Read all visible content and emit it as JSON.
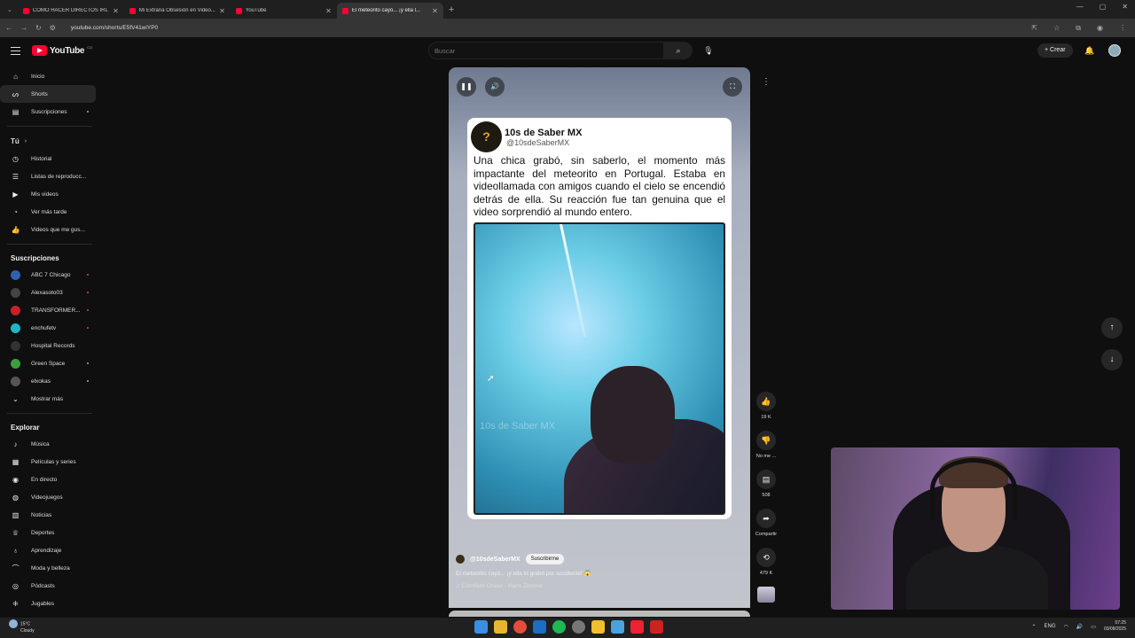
{
  "browser": {
    "tabs": [
      {
        "label": "COMO HACER DIRECTOS IRL"
      },
      {
        "label": "Mi Extraña Obsesión en Video..."
      },
      {
        "label": "YouTube"
      },
      {
        "label": "El meteorito cayó... ¡y ella l..."
      }
    ],
    "url": "youtube.com/shorts/E5fV41wiYP0"
  },
  "header": {
    "logo_text": "YouTube",
    "logo_country": "CO",
    "search_placeholder": "Buscar",
    "create_label": "Crear"
  },
  "sidebar": {
    "main": [
      {
        "label": "Inicio",
        "icon": "home-icon"
      },
      {
        "label": "Shorts",
        "icon": "shorts-icon"
      },
      {
        "label": "Suscripciones",
        "icon": "subscriptions-icon"
      }
    ],
    "you_title": "Tú",
    "you": [
      {
        "label": "Historial"
      },
      {
        "label": "Listas de reproducc..."
      },
      {
        "label": "Mis videos"
      },
      {
        "label": "Ver más tarde"
      },
      {
        "label": "Videos que me gus..."
      }
    ],
    "subs_title": "Suscripciones",
    "subs": [
      {
        "label": "ABC 7 Chicago",
        "color": "#2d62b0"
      },
      {
        "label": "Alexasoto03",
        "color": "#444444"
      },
      {
        "label": "TRANSFORMER...",
        "color": "#c8202a"
      },
      {
        "label": "enchufetv",
        "color": "#1fb5c4"
      },
      {
        "label": "Hospital Records",
        "color": "#333333"
      },
      {
        "label": "Green Space",
        "color": "#3e9e3e"
      },
      {
        "label": "elxokas",
        "color": "#555555"
      }
    ],
    "show_more": "Mostrar más",
    "explore_title": "Explorar",
    "explore": [
      {
        "label": "Música"
      },
      {
        "label": "Películas y series"
      },
      {
        "label": "En directo"
      },
      {
        "label": "Videojuegos"
      },
      {
        "label": "Noticias"
      },
      {
        "label": "Deportes"
      },
      {
        "label": "Aprendizaje"
      },
      {
        "label": "Moda y belleza"
      },
      {
        "label": "Pódcasts"
      },
      {
        "label": "Jugables"
      }
    ]
  },
  "short": {
    "channel_name": "10s de Saber MX",
    "channel_handle": "@10sdeSaberMX",
    "caption": "Una chica grabó, sin saberlo, el momento más impactante del meteorito en Portugal. Estaba en videollamada con amigos cuando el cielo se encendió detrás de ella. Su reacción fue tan genuina que el video sorprendió al mundo entero.",
    "watermark": "10s de Saber MX",
    "meta_handle": "@10sdeSaberMX",
    "subscribe_label": "Suscribirme",
    "title": "El meteorito cayó... ¡y ella lo grabó por accidente! 😱",
    "song": "♫ Cornfield Chase · Hans Zimmer"
  },
  "actions": {
    "likes": "19 K",
    "dislike_label": "No me ...",
    "comments": "508",
    "share_label": "Compartir",
    "remix": "479 K"
  },
  "taskbar": {
    "temp": "15°C",
    "weather": "Cloudy",
    "lang": "ENG",
    "time": "07:25",
    "date": "03/08/2025"
  }
}
